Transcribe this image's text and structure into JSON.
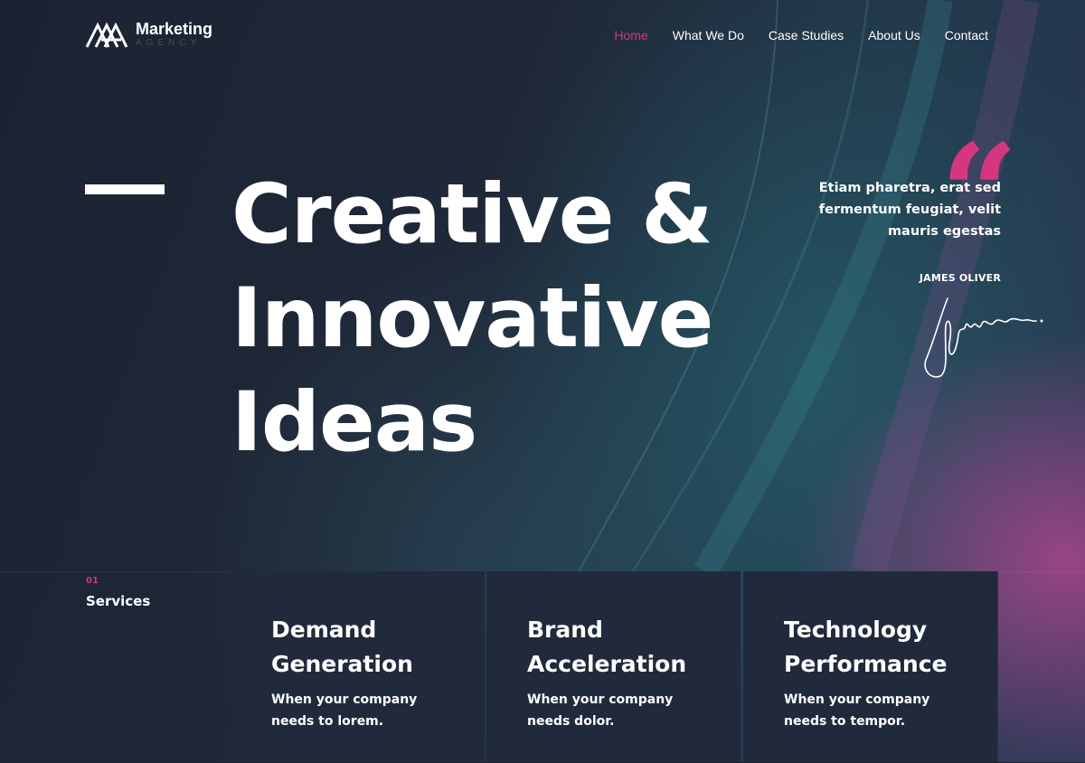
{
  "brand": {
    "name": "Marketing",
    "subtitle": "AGENCY"
  },
  "nav": {
    "items": [
      {
        "label": "Home",
        "active": true
      },
      {
        "label": "What We Do",
        "active": false
      },
      {
        "label": "Case Studies",
        "active": false
      },
      {
        "label": "About Us",
        "active": false
      },
      {
        "label": "Contact",
        "active": false
      }
    ]
  },
  "hero": {
    "title": "Creative &\nInnovative\nIdeas"
  },
  "quote": {
    "mark_icon": "quote-icon",
    "text": "Etiam pharetra, erat sed fermentum feugiat, velit mauris egestas",
    "author": "JAMES OLIVER"
  },
  "services": {
    "number": "01",
    "heading": "Services",
    "cards": [
      {
        "title": "Demand\nGeneration",
        "description": "When your company\nneeds to lorem."
      },
      {
        "title": "Brand\nAcceleration",
        "description": "When your company\nneeds dolor."
      },
      {
        "title": "Technology\nPerformance",
        "description": "When your company\nneeds to tempor."
      }
    ]
  },
  "colors": {
    "accent": "#d6367f",
    "background": "#1c2233",
    "card": "#202a3c"
  }
}
